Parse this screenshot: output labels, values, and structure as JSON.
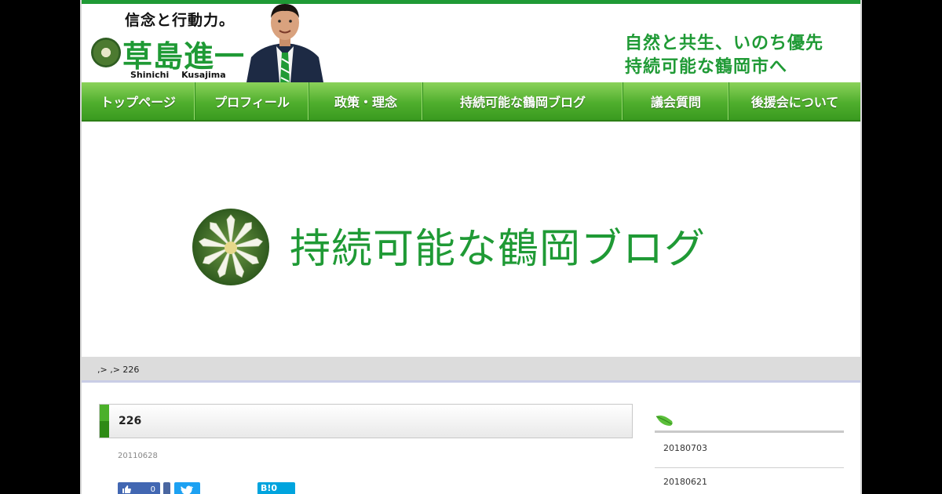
{
  "header": {
    "slogan": "信念と行動力。",
    "name": "草島進一",
    "romaji": "Shinichi Kusajima",
    "tagline_line1": "自然と共生、いのち優先",
    "tagline_line2": "持続可能な鶴岡市へ"
  },
  "nav": {
    "items": [
      {
        "label": "トップページ"
      },
      {
        "label": "プロフィール"
      },
      {
        "label": "政策・理念"
      },
      {
        "label": "持続可能な鶴岡ブログ"
      },
      {
        "label": "議会質問"
      },
      {
        "label": "後援会について"
      }
    ]
  },
  "banner": {
    "title": "持続可能な鶴岡ブログ"
  },
  "breadcrumb": {
    "text": ",> ,> 226"
  },
  "post": {
    "title": "226",
    "date": "20110628",
    "fb_count": "0",
    "hatena_label": "B!0"
  },
  "sidebar": {
    "items": [
      {
        "label": "20180703"
      },
      {
        "label": "20180621"
      }
    ]
  },
  "colors": {
    "brand_green": "#1f9a35",
    "nav_green": "#4fae2d"
  }
}
